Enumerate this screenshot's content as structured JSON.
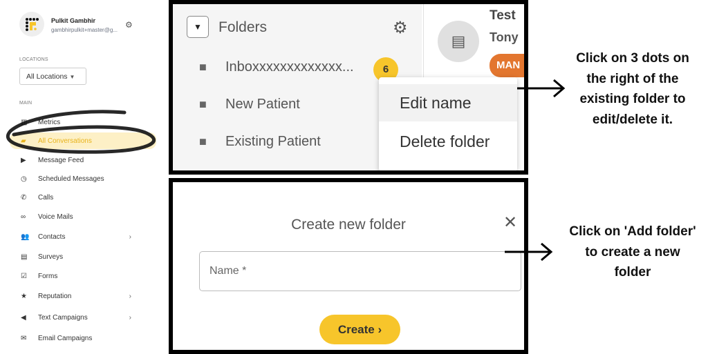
{
  "sidebar": {
    "user_name": "Pulkit Gambhir",
    "user_email": "gambhirpulkit+master@g...",
    "locations_label": "LOCATIONS",
    "location_select": "All Locations",
    "main_label": "MAIN",
    "items": [
      {
        "label": "Metrics",
        "icon": "bar-chart-icon"
      },
      {
        "label": "All Conversations",
        "icon": "chat-icon",
        "active": true
      },
      {
        "label": "Message Feed",
        "icon": "feed-icon"
      },
      {
        "label": "Scheduled Messages",
        "icon": "timer-icon"
      },
      {
        "label": "Calls",
        "icon": "phone-icon"
      },
      {
        "label": "Voice Mails",
        "icon": "voicemail-icon"
      },
      {
        "label": "Contacts",
        "icon": "people-icon",
        "chevron": true
      },
      {
        "label": "Surveys",
        "icon": "document-icon"
      },
      {
        "label": "Forms",
        "icon": "checkbox-icon"
      },
      {
        "label": "Reputation",
        "icon": "star-icon",
        "chevron": true
      },
      {
        "label": "Text Campaigns",
        "icon": "megaphone-icon",
        "chevron": true
      },
      {
        "label": "Email Campaigns",
        "icon": "mail-icon"
      }
    ]
  },
  "folders": {
    "title": "Folders",
    "items": [
      {
        "label": "Inboxxxxxxxxxxxxx...",
        "badge": "6"
      },
      {
        "label": "New Patient"
      },
      {
        "label": "Existing Patient"
      }
    ],
    "menu": [
      "Edit name",
      "Delete folder"
    ],
    "conversation": {
      "title": "Test",
      "name": "Tony",
      "tag": "MAN"
    }
  },
  "dialog": {
    "title": "Create new folder",
    "name_placeholder": "Name *",
    "create_label": "Create"
  },
  "annotations": {
    "edit_note": [
      "Click on 3 dots on",
      "the right of the",
      "existing folder to",
      "edit/delete it."
    ],
    "add_note": [
      "Click on 'Add folder'",
      "to create a new",
      "folder"
    ]
  },
  "colors": {
    "accent": "#f7c52b",
    "active_bg": "#fdf0c6",
    "tag": "#e3762f"
  }
}
